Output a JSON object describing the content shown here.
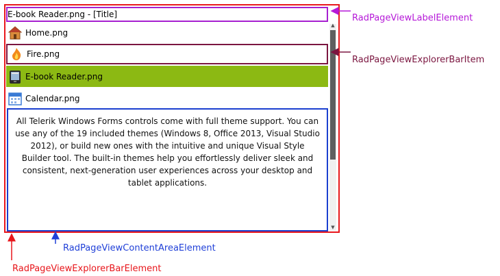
{
  "title_label": "E-book Reader.png - [Title]",
  "items": [
    {
      "label": "Home.png",
      "icon": "home-icon"
    },
    {
      "label": "Fire.png",
      "icon": "fire-icon"
    },
    {
      "label": "E-book Reader.png",
      "icon": "ebook-reader-icon"
    },
    {
      "label": "Calendar.png",
      "icon": "calendar-icon"
    }
  ],
  "content_text": "All Telerik Windows Forms controls come with full theme support. You can use any of the 19 included themes (Windows 8, Office 2013, Visual Studio 2012), or build new ones with the intuitive and unique Visual Style Builder tool. The built-in themes help you effortlessly deliver sleek and consistent, next-generation user experiences across your desktop and tablet applications.",
  "callouts": {
    "label_element": "RadPageViewLabelElement",
    "explorer_bar_item": "RadPageViewExplorerBarItem",
    "content_area_element": "RadPageViewContentAreaElement",
    "explorer_bar_element": "RadPageViewExplorerBarElement"
  },
  "colors": {
    "explorer_frame": "#e8161b",
    "label_frame": "#a61fd0",
    "item_frame": "#7b1640",
    "selected_item": "#8cb913",
    "content_frame": "#1a3fcf"
  }
}
